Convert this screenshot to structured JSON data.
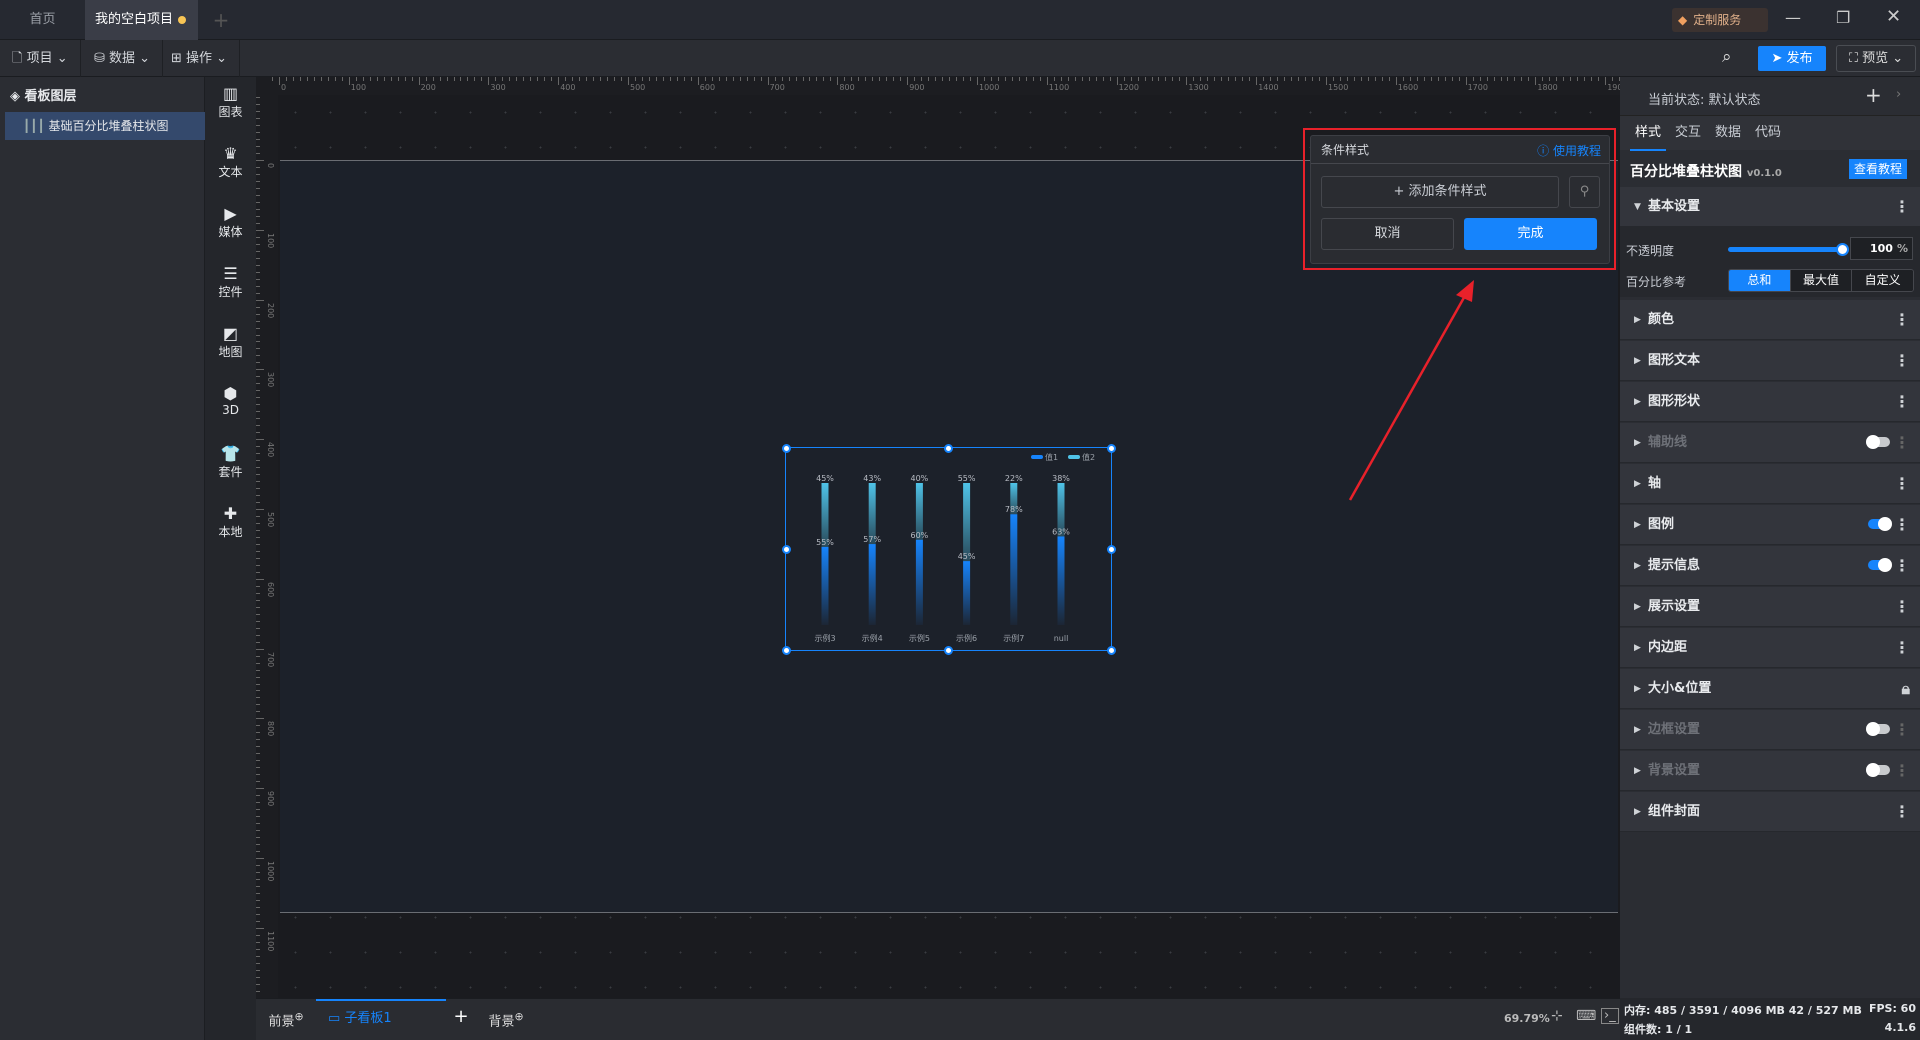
{
  "titlebar": {
    "tabs": [
      {
        "label": "首页"
      },
      {
        "label": "我的空白项目"
      }
    ],
    "service": "定制服务",
    "modified_dot_color": "#f8c555"
  },
  "toolbar": {
    "menus": [
      "项目",
      "数据",
      "操作"
    ],
    "publish": "发布",
    "preview": "预览"
  },
  "layers": {
    "title": "看板图层",
    "items": [
      "基础百分比堆叠柱状图"
    ]
  },
  "iconbar": [
    "图表",
    "文本",
    "媒体",
    "控件",
    "地图",
    "3D",
    "套件",
    "本地"
  ],
  "ruler": {
    "top": [
      "0",
      "100",
      "200",
      "300",
      "400",
      "500",
      "600",
      "700",
      "800",
      "900",
      "1000",
      "1100",
      "1200",
      "1300",
      "1400",
      "1500",
      "1600",
      "1700",
      "1800",
      "1900"
    ],
    "left": [
      "0",
      "100",
      "200",
      "300",
      "400",
      "500",
      "600",
      "700",
      "800",
      "900",
      "1000",
      "1100"
    ]
  },
  "popup": {
    "title": "条件样式",
    "help": "使用教程",
    "add": "+ 添加条件样式",
    "cancel": "取消",
    "done": "完成"
  },
  "right": {
    "state_label": "当前状态:",
    "state_value": "默认状态",
    "tabs": [
      "样式",
      "交互",
      "数据",
      "代码"
    ],
    "active_tab": "样式",
    "component": "百分比堆叠柱状图",
    "version": "v0.1.0",
    "tutorial": "查看教程",
    "basic": "基本设置",
    "opacity_label": "不透明度",
    "opacity": 100,
    "opacity_unit": "%",
    "ref_label": "百分比参考",
    "ref_options": [
      "总和",
      "最大值",
      "自定义"
    ],
    "ref_selected": "总和",
    "sections": [
      {
        "label": "颜色"
      },
      {
        "label": "图形文本"
      },
      {
        "label": "图形形状"
      },
      {
        "label": "辅助线",
        "toggle": false,
        "disabled": true
      },
      {
        "label": "轴"
      },
      {
        "label": "图例",
        "toggle": true
      },
      {
        "label": "提示信息",
        "toggle": true
      },
      {
        "label": "展示设置"
      },
      {
        "label": "内边距"
      },
      {
        "label": "大小&位置",
        "lock": true
      },
      {
        "label": "边框设置",
        "toggle": false,
        "disabled": true
      },
      {
        "label": "背景设置",
        "toggle": false,
        "disabled": true
      },
      {
        "label": "组件封面"
      }
    ]
  },
  "bottom": {
    "front": "前景",
    "board": "子看板1",
    "back": "背景",
    "zoom": "69.79%"
  },
  "status": {
    "memory": "内存: 485 / 3591 / 4096 MB  42 / 527 MB",
    "fps": "FPS: 60",
    "count": "组件数: 1 / 1",
    "version": "4.1.6"
  },
  "chart_data": {
    "type": "bar",
    "stacked": "percent",
    "categories": [
      "示例3",
      "示例4",
      "示例5",
      "示例6",
      "示例7",
      "null"
    ],
    "series": [
      {
        "name": "值1",
        "values": [
          55,
          57,
          60,
          45,
          78,
          63
        ],
        "color": "#1684fc"
      },
      {
        "name": "值2",
        "values": [
          45,
          43,
          40,
          55,
          22,
          38
        ],
        "color": "#4fc3e8"
      }
    ],
    "legend": "top-right",
    "ylim": [
      0,
      100
    ],
    "value_suffix": "%"
  }
}
